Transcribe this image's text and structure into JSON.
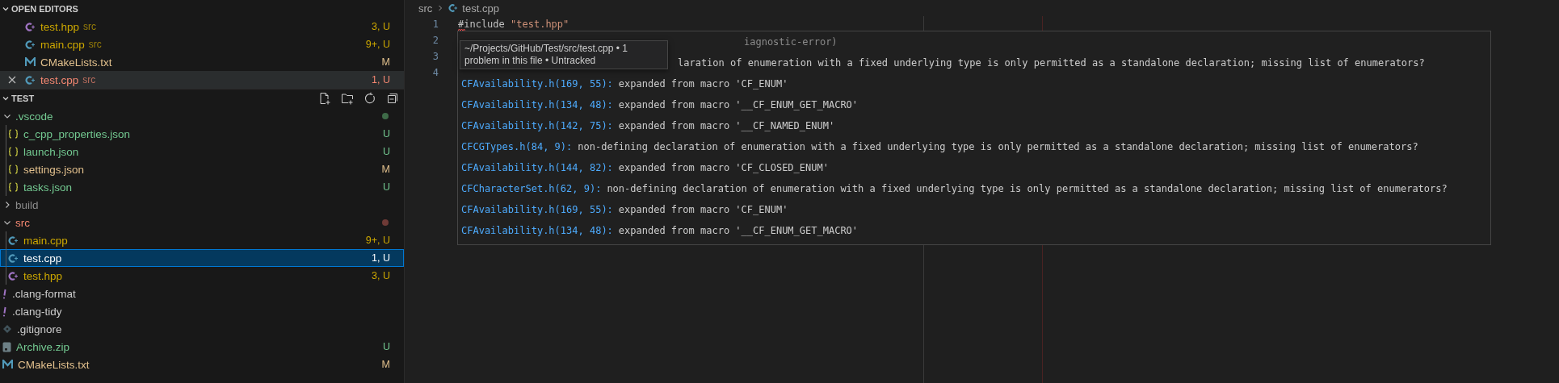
{
  "open_editors": {
    "title": "OPEN EDITORS",
    "expanded": true,
    "items": [
      {
        "name": "test.hpp",
        "folder": "src",
        "badge": "3, U",
        "kind": "hpp",
        "color": "#cca700",
        "selected": false
      },
      {
        "name": "main.cpp",
        "folder": "src",
        "badge": "9+, U",
        "kind": "cpp",
        "color": "#cca700",
        "selected": false
      },
      {
        "name": "CMakeLists.txt",
        "badge": "M",
        "kind": "cmake",
        "color": "#e2c08d",
        "selected": false
      },
      {
        "name": "test.cpp",
        "folder": "src",
        "badge": "1, U",
        "kind": "cpp",
        "color": "#f48771",
        "selected": true
      }
    ]
  },
  "explorer": {
    "title": "TEST",
    "expanded": true,
    "items": [
      {
        "name": ".vscode",
        "kind": "folder",
        "expanded": true,
        "color": "#73c991",
        "dot": {
          "color": "#3e6b48"
        },
        "selected": false,
        "children": [
          {
            "name": "c_cpp_properties.json",
            "kind": "json",
            "color": "#73c991",
            "badge": "U",
            "selected": false
          },
          {
            "name": "launch.json",
            "kind": "json",
            "color": "#73c991",
            "badge": "U",
            "selected": false
          },
          {
            "name": "settings.json",
            "kind": "json",
            "color": "#e2c08d",
            "badge": "M",
            "selected": false
          },
          {
            "name": "tasks.json",
            "kind": "json",
            "color": "#73c991",
            "badge": "U",
            "selected": false
          }
        ]
      },
      {
        "name": "build",
        "kind": "folder",
        "expanded": false,
        "color": "#8c8c8c",
        "selected": false
      },
      {
        "name": "src",
        "kind": "folder",
        "expanded": true,
        "color": "#f48771",
        "dot": {
          "color": "#6e3a36"
        },
        "selected": false,
        "children": [
          {
            "name": "main.cpp",
            "kind": "cpp",
            "color": "#cca700",
            "badge": "9+, U",
            "selected": false
          },
          {
            "name": "test.cpp",
            "kind": "cpp",
            "badge": "1, U",
            "selected": true
          },
          {
            "name": "test.hpp",
            "kind": "hpp",
            "color": "#cca700",
            "badge": "3, U",
            "selected": false
          }
        ]
      },
      {
        "name": ".clang-format",
        "kind": "bang",
        "color": "#cccccc",
        "selected": false
      },
      {
        "name": ".clang-tidy",
        "kind": "bang",
        "color": "#cccccc",
        "selected": false
      },
      {
        "name": ".gitignore",
        "kind": "git",
        "color": "#cccccc",
        "selected": false
      },
      {
        "name": "Archive.zip",
        "kind": "zip",
        "color": "#73c991",
        "badge": "U",
        "selected": false
      },
      {
        "name": "CMakeLists.txt",
        "kind": "cmake",
        "color": "#e2c08d",
        "badge": "M",
        "selected": false
      }
    ]
  },
  "breadcrumb": {
    "folder": "src",
    "file": "test.cpp"
  },
  "code_lines": [
    {
      "number": "1",
      "error": true,
      "tokens": [
        {
          "kind": "directive",
          "text": "#include "
        },
        {
          "kind": "string",
          "text": "\"test.hpp\""
        }
      ]
    },
    {
      "number": "2",
      "error": false
    },
    {
      "number": "3",
      "error": false
    },
    {
      "number": "4",
      "error": false
    }
  ],
  "hover": {
    "lines": [
      {
        "kind": "source-tail",
        "text": "iagnostic-error)"
      },
      {
        "kind": "message-tail",
        "text": "laration of enumeration with a fixed underlying type is only permitted as a standalone declaration; missing list of enumerators?"
      },
      {
        "kind": "related",
        "link": "CFAvailability.h(169, 55):",
        "text": "expanded from macro 'CF_ENUM'"
      },
      {
        "kind": "related",
        "link": "CFAvailability.h(134, 48):",
        "text": "expanded from macro '__CF_ENUM_GET_MACRO'"
      },
      {
        "kind": "related",
        "link": "CFAvailability.h(142, 75):",
        "text": "expanded from macro '__CF_NAMED_ENUM'"
      },
      {
        "kind": "related",
        "link": "CFCGTypes.h(84, 9):",
        "text": "non-defining declaration of enumeration with a fixed underlying type is only permitted as a standalone declaration; missing list of enumerators?"
      },
      {
        "kind": "related",
        "link": "CFAvailability.h(144, 82):",
        "text": "expanded from macro 'CF_CLOSED_ENUM'"
      },
      {
        "kind": "related",
        "link": "CFCharacterSet.h(62, 9):",
        "text": "non-defining declaration of enumeration with a fixed underlying type is only permitted as a standalone declaration; missing list of enumerators?"
      },
      {
        "kind": "related",
        "link": "CFAvailability.h(169, 55):",
        "text": "expanded from macro 'CF_ENUM'"
      },
      {
        "kind": "related",
        "link": "CFAvailability.h(134, 48):",
        "text": "expanded from macro '__CF_ENUM_GET_MACRO'"
      }
    ]
  },
  "tooltip": {
    "text": "~/Projects/GitHub/Test/src/test.cpp • 1 problem in this file • Untracked"
  }
}
